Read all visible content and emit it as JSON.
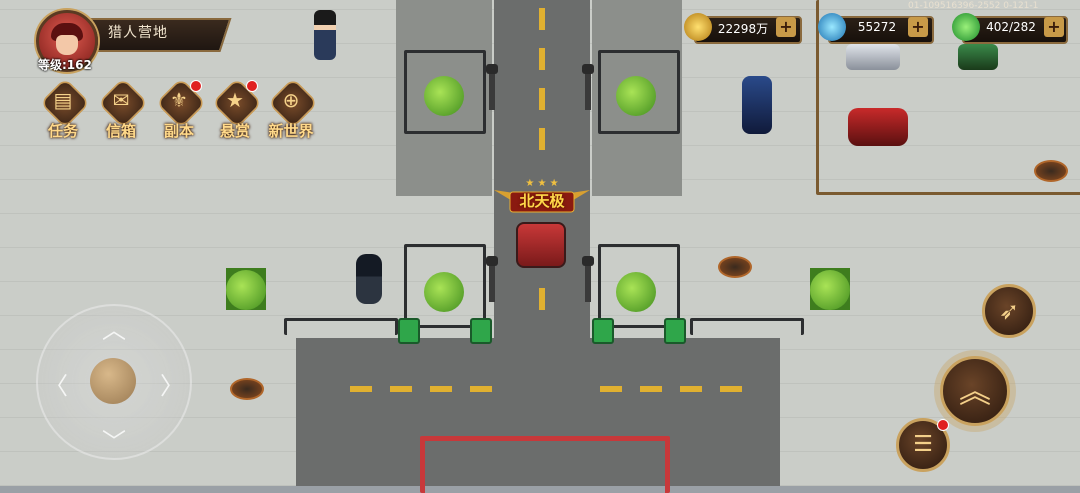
{
  "player": {
    "name": "猎人营地",
    "level": "等级:162"
  },
  "menu": [
    {
      "label": "任务",
      "icon": "scroll-icon",
      "glyph": "▤",
      "badge": false
    },
    {
      "label": "信箱",
      "icon": "mailbox-icon",
      "glyph": "✉",
      "badge": false
    },
    {
      "label": "副本",
      "icon": "dungeon-icon",
      "glyph": "⚜",
      "badge": true
    },
    {
      "label": "悬赏",
      "icon": "bounty-star-icon",
      "glyph": "★",
      "badge": true
    },
    {
      "label": "新世界",
      "icon": "globe-icon",
      "glyph": "⊕",
      "badge": false
    }
  ],
  "resources": {
    "gold": {
      "value": "22298万",
      "icon": "gold-coin-icon",
      "color": "#e8b830"
    },
    "crystal": {
      "value": "55272",
      "icon": "blue-crystal-icon",
      "color": "#3ab0e8"
    },
    "energy": {
      "value": "402/282",
      "icon": "green-gem-icon",
      "color": "#38d04a"
    },
    "plus": "+"
  },
  "server_id": "01-109516396-2552 0-121-1",
  "map_title": "北天极",
  "actions": {
    "skill": {
      "icon": "missile-skill-icon",
      "glyph": "➶"
    },
    "jump": {
      "icon": "rank-chevrons-icon",
      "glyph": "︽"
    },
    "menu": {
      "icon": "list-menu-icon",
      "glyph": "☰"
    }
  },
  "colors": {
    "gold_text": "#ffd98a",
    "frame": "#c9a25f",
    "road": "#6b6d6c"
  }
}
